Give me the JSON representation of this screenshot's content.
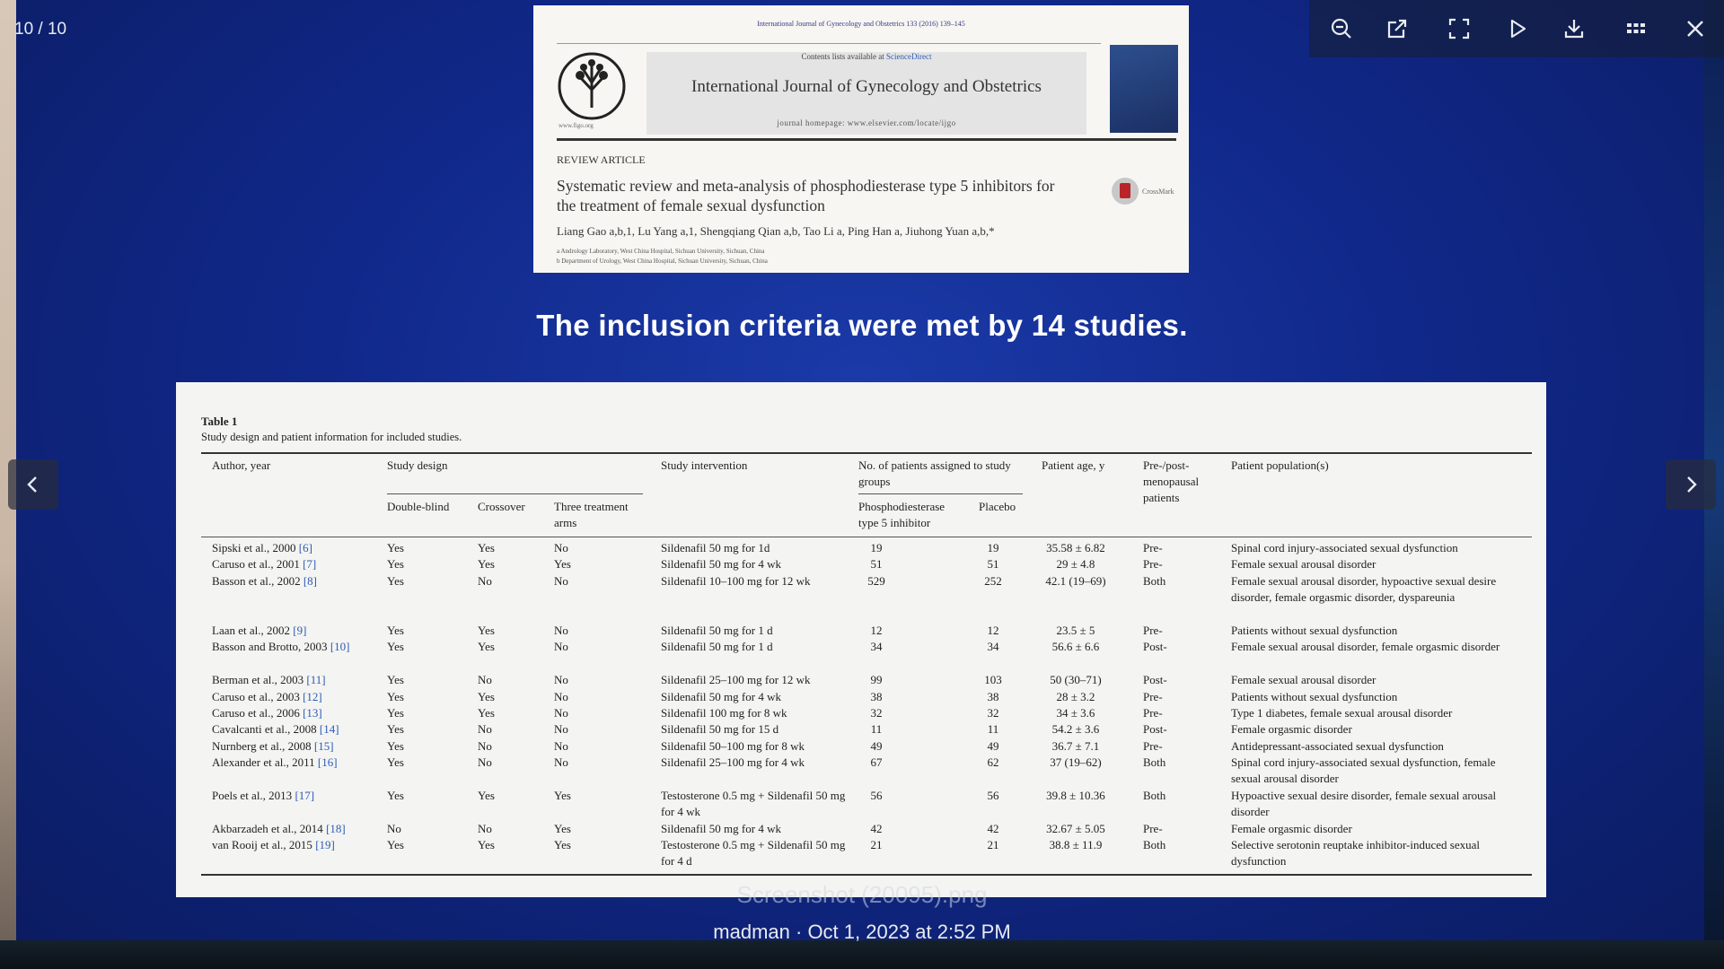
{
  "viewer": {
    "counter": "10 / 10",
    "filename": "Screenshot (20095).png",
    "meta": "madman · Oct 1, 2023 at 2:52 PM",
    "toolbar": [
      {
        "name": "zoom-out",
        "icon": "zoom-out-icon"
      },
      {
        "name": "open-external",
        "icon": "open-external-icon"
      },
      {
        "name": "fullscreen",
        "icon": "fullscreen-icon"
      },
      {
        "name": "slideshow-play",
        "icon": "play-icon"
      },
      {
        "name": "download",
        "icon": "download-icon"
      },
      {
        "name": "grid-view",
        "icon": "grid-icon"
      },
      {
        "name": "close",
        "icon": "close-icon"
      }
    ],
    "colors": {
      "slide_blue": "#10288a",
      "panel": "#f4f4f2",
      "link": "#2b5bb5"
    }
  },
  "article": {
    "journal_line": "International Journal of Gynecology and Obstetrics 133 (2016) 139–145",
    "contents_prefix": "Contents lists available at ",
    "contents_link": "ScienceDirect",
    "journal_title": "International Journal of Gynecology and Obstetrics",
    "homepage": "journal homepage: www.elsevier.com/locate/ijgo",
    "logo_url": "www.figo.org",
    "kind": "REVIEW ARTICLE",
    "title": "Systematic review and meta-analysis of phosphodiesterase type 5 inhibitors for the treatment of female sexual dysfunction",
    "authors": "Liang Gao a,b,1, Lu Yang a,1, Shengqiang Qian a,b, Tao Li a, Ping Han a, Jiuhong Yuan a,b,*",
    "affiliation_a": "a Andrology Laboratory, West China Hospital, Sichuan University, Sichuan, China",
    "affiliation_b": "b Department of Urology, West China Hospital, Sichuan University, Sichuan, China",
    "crossmark": "CrossMark"
  },
  "slide": {
    "heading": "The inclusion criteria were met by 14 studies."
  },
  "table": {
    "caption": "Table 1",
    "subtitle": "Study design and patient information for included studies.",
    "headers": {
      "author": "Author, year",
      "design": "Study design",
      "double_blind": "Double-blind",
      "crossover": "Crossover",
      "three_arms": "Three treatment arms",
      "intervention": "Study intervention",
      "patients": "No. of patients assigned to study groups",
      "pde5": "Phosphodiesterase type 5 inhibitor",
      "placebo": "Placebo",
      "age": "Patient age, y",
      "meno": "Pre-/post-menopausal patients",
      "population": "Patient population(s)"
    },
    "rows": [
      {
        "author": "Sipski et al., 2000",
        "ref": "[6]",
        "db": "Yes",
        "co": "Yes",
        "ta": "No",
        "intervention": "Sildenafil 50 mg for 1d",
        "pde5": "19",
        "placebo": "19",
        "age": "35.58 ± 6.82",
        "meno": "Pre-",
        "population": "Spinal cord injury-associated sexual dysfunction"
      },
      {
        "author": "Caruso et al., 2001",
        "ref": "[7]",
        "db": "Yes",
        "co": "Yes",
        "ta": "Yes",
        "intervention": "Sildenafil 50 mg for 4 wk",
        "pde5": "51",
        "placebo": "51",
        "age": "29 ± 4.8",
        "meno": "Pre-",
        "population": "Female sexual arousal disorder"
      },
      {
        "author": "Basson et al., 2002",
        "ref": "[8]",
        "db": "Yes",
        "co": "No",
        "ta": "No",
        "intervention": "Sildenafil 10–100 mg for 12 wk",
        "pde5": "529",
        "placebo": "252",
        "age": "42.1 (19–69)",
        "meno": "Both",
        "population": "Female sexual arousal disorder, hypoactive sexual desire disorder, female orgasmic disorder, dyspareunia"
      },
      {
        "author": "Laan et al., 2002",
        "ref": "[9]",
        "db": "Yes",
        "co": "Yes",
        "ta": "No",
        "intervention": "Sildenafil 50 mg for 1 d",
        "pde5": "12",
        "placebo": "12",
        "age": "23.5 ± 5",
        "meno": "Pre-",
        "population": "Patients without sexual dysfunction"
      },
      {
        "author": "Basson and Brotto, 2003",
        "ref": "[10]",
        "db": "Yes",
        "co": "Yes",
        "ta": "No",
        "intervention": "Sildenafil 50 mg for 1 d",
        "pde5": "34",
        "placebo": "34",
        "age": "56.6 ± 6.6",
        "meno": "Post-",
        "population": "Female sexual arousal disorder, female orgasmic disorder"
      },
      {
        "author": "Berman et al., 2003",
        "ref": "[11]",
        "db": "Yes",
        "co": "No",
        "ta": "No",
        "intervention": "Sildenafil 25–100 mg for 12 wk",
        "pde5": "99",
        "placebo": "103",
        "age": "50 (30–71)",
        "meno": "Post-",
        "population": "Female sexual arousal disorder"
      },
      {
        "author": "Caruso et al., 2003",
        "ref": "[12]",
        "db": "Yes",
        "co": "Yes",
        "ta": "No",
        "intervention": "Sildenafil 50 mg for 4 wk",
        "pde5": "38",
        "placebo": "38",
        "age": "28 ± 3.2",
        "meno": "Pre-",
        "population": "Patients without sexual dysfunction"
      },
      {
        "author": "Caruso et al., 2006",
        "ref": "[13]",
        "db": "Yes",
        "co": "Yes",
        "ta": "No",
        "intervention": "Sildenafil 100 mg for 8 wk",
        "pde5": "32",
        "placebo": "32",
        "age": "34 ± 3.6",
        "meno": "Pre-",
        "population": "Type 1 diabetes, female sexual arousal disorder"
      },
      {
        "author": "Cavalcanti et al., 2008",
        "ref": "[14]",
        "db": "Yes",
        "co": "No",
        "ta": "No",
        "intervention": "Sildenafil 50 mg for 15 d",
        "pde5": "11",
        "placebo": "11",
        "age": "54.2 ± 3.6",
        "meno": "Post-",
        "population": "Female orgasmic disorder"
      },
      {
        "author": "Nurnberg et al., 2008",
        "ref": "[15]",
        "db": "Yes",
        "co": "No",
        "ta": "No",
        "intervention": "Sildenafil 50–100 mg for 8 wk",
        "pde5": "49",
        "placebo": "49",
        "age": "36.7 ± 7.1",
        "meno": "Pre-",
        "population": "Antidepressant-associated sexual dysfunction"
      },
      {
        "author": "Alexander et al., 2011",
        "ref": "[16]",
        "db": "Yes",
        "co": "No",
        "ta": "No",
        "intervention": "Sildenafil 25–100 mg for 4 wk",
        "pde5": "67",
        "placebo": "62",
        "age": "37 (19–62)",
        "meno": "Both",
        "population": "Spinal cord injury-associated sexual dysfunction, female sexual arousal disorder"
      },
      {
        "author": "Poels et al., 2013",
        "ref": "[17]",
        "db": "Yes",
        "co": "Yes",
        "ta": "Yes",
        "intervention": "Testosterone 0.5 mg + Sildenafil 50 mg for 4 wk",
        "pde5": "56",
        "placebo": "56",
        "age": "39.8 ± 10.36",
        "meno": "Both",
        "population": "Hypoactive sexual desire disorder, female sexual arousal disorder"
      },
      {
        "author": "Akbarzadeh et al., 2014",
        "ref": "[18]",
        "db": "No",
        "co": "No",
        "ta": "Yes",
        "intervention": "Sildenafil 50 mg for 4 wk",
        "pde5": "42",
        "placebo": "42",
        "age": "32.67 ± 5.05",
        "meno": "Pre-",
        "population": "Female orgasmic disorder"
      },
      {
        "author": "van Rooij et al., 2015",
        "ref": "[19]",
        "db": "Yes",
        "co": "Yes",
        "ta": "Yes",
        "intervention": "Testosterone 0.5 mg + Sildenafil 50 mg for 4 d",
        "pde5": "21",
        "placebo": "21",
        "age": "38.8 ± 11.9",
        "meno": "Both",
        "population": "Selective serotonin reuptake inhibitor-induced sexual dysfunction"
      }
    ]
  }
}
